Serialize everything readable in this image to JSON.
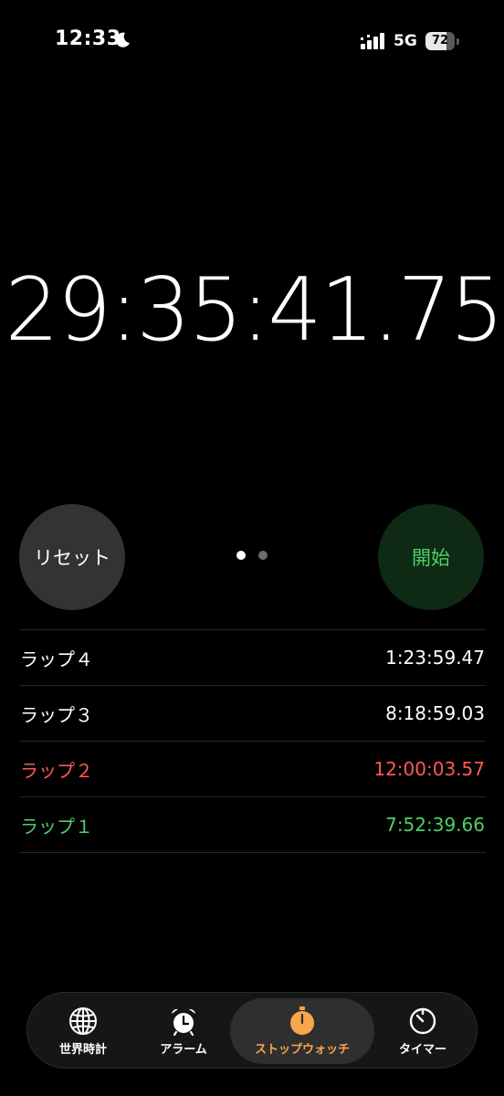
{
  "status_bar": {
    "time": "12:33",
    "network": "5G",
    "battery_percent": "72",
    "battery_level": 0.72,
    "icons": [
      "moon-icon",
      "signal-icon",
      "battery-icon"
    ]
  },
  "stopwatch": {
    "display": "29:35:41.75",
    "reset_label": "リセット",
    "start_label": "開始",
    "colors": {
      "start_text": "#4fd066",
      "start_bg": "#0f2a14",
      "reset_bg": "#333336"
    }
  },
  "laps": [
    {
      "label": "ラップ４",
      "time": "1:23:59.47",
      "color": "#ffffff"
    },
    {
      "label": "ラップ３",
      "time": "8:18:59.03",
      "color": "#ffffff"
    },
    {
      "label": "ラップ２",
      "time": "12:00:03.57",
      "color": "#ff5a52"
    },
    {
      "label": "ラップ１",
      "time": "7:52:39.66",
      "color": "#4fd066"
    }
  ],
  "tabs": [
    {
      "label": "世界時計",
      "icon": "globe-icon"
    },
    {
      "label": "アラーム",
      "icon": "alarm-clock-icon"
    },
    {
      "label": "ストップウォッチ",
      "icon": "stopwatch-icon",
      "selected": true
    },
    {
      "label": "タイマー",
      "icon": "timer-icon"
    }
  ],
  "accent_color": "#f7a64a"
}
